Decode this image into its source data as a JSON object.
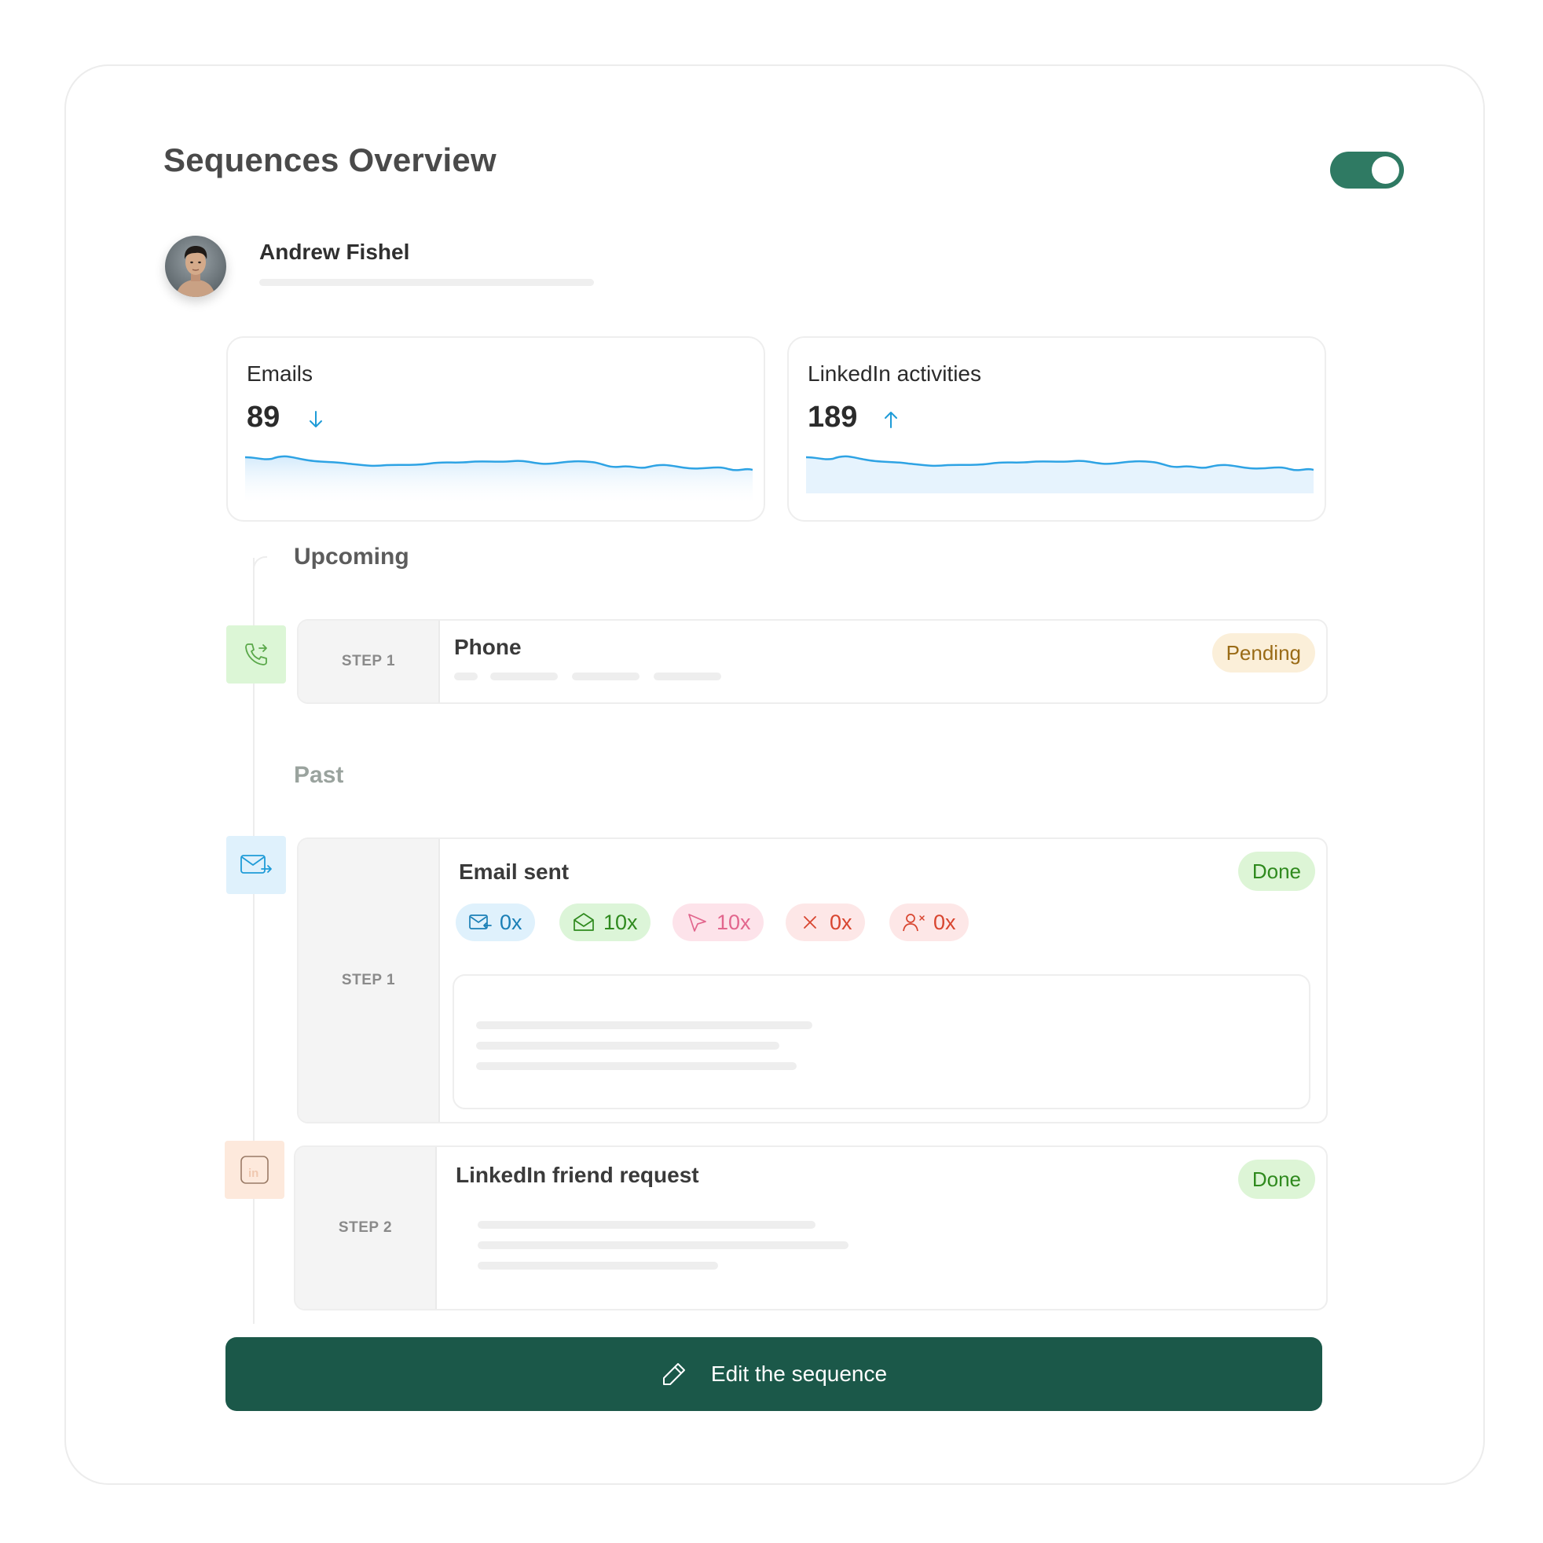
{
  "colors": {
    "accent": "#1b5849",
    "toggle_on": "#2f7a63",
    "email_blue": "#1e9bd7",
    "phone_green": "#5aa84a",
    "pending_bg": "#fbefd9",
    "pending_text": "#9a6b16",
    "done_bg": "#ddf5d6",
    "done_text": "#2f8a1e"
  },
  "header": {
    "title": "Sequences Overview",
    "toggle_on": true
  },
  "user": {
    "name": "Andrew Fishel"
  },
  "stats": [
    {
      "label": "Emails",
      "value": "89",
      "trend": "down"
    },
    {
      "label": "LinkedIn activities",
      "value": "189",
      "trend": "up"
    }
  ],
  "sections": {
    "upcoming": "Upcoming",
    "past": "Past"
  },
  "steps": {
    "phone": {
      "step_label": "STEP 1",
      "title": "Phone",
      "status": "Pending",
      "icon": "phone-forward-icon"
    },
    "email": {
      "step_label": "STEP 1",
      "title": "Email sent",
      "status": "Done",
      "icon": "email-send-icon",
      "metrics": [
        {
          "name": "replied",
          "value": "0x",
          "icon": "mail-reply-icon",
          "bg": "#dff1fc",
          "fg": "#1a7fb6"
        },
        {
          "name": "opened",
          "value": "10x",
          "icon": "mail-open-icon",
          "bg": "#dcf5d8",
          "fg": "#2f8a1e"
        },
        {
          "name": "clicked",
          "value": "10x",
          "icon": "cursor-click-icon",
          "bg": "#fde3ea",
          "fg": "#e2668d"
        },
        {
          "name": "bounced",
          "value": "0x",
          "icon": "close-icon",
          "bg": "#fde7e7",
          "fg": "#d8452f"
        },
        {
          "name": "unsubscribed",
          "value": "0x",
          "icon": "user-remove-icon",
          "bg": "#fde7e7",
          "fg": "#d8452f"
        }
      ]
    },
    "linkedin": {
      "step_label": "STEP 2",
      "title": "LinkedIn friend request",
      "status": "Done",
      "icon": "linkedin-icon"
    }
  },
  "actions": {
    "edit_label": "Edit the sequence"
  }
}
